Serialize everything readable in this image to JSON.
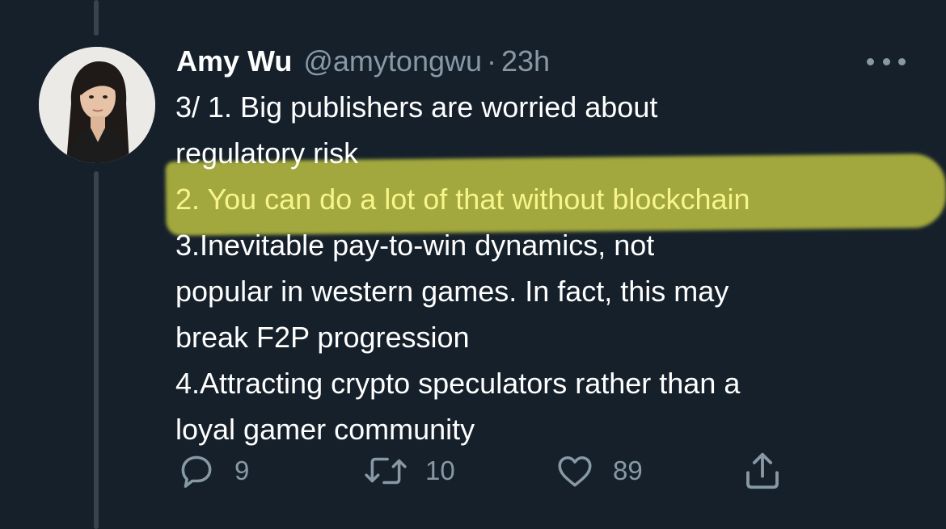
{
  "tweet": {
    "author_name": "Amy Wu",
    "handle": "@amytongwu",
    "separator": "·",
    "time": "23h",
    "lines": [
      "3/ 1. Big publishers are worried about",
      "regulatory risk",
      "2. You can do a lot of that without blockchain",
      "3.Inevitable pay-to-win dynamics, not",
      "popular in western games. In fact, this may",
      "break F2P progression",
      "4.Attracting crypto speculators rather than a",
      "loyal gamer community"
    ],
    "highlighted_line_index": 2,
    "highlight_color": "#c9ce42"
  },
  "actions": {
    "reply_count": "9",
    "retweet_count": "10",
    "like_count": "89"
  },
  "icons": {
    "more": "more-horizontal-icon",
    "reply": "reply-icon",
    "retweet": "retweet-icon",
    "like": "heart-icon",
    "share": "share-icon"
  },
  "colors": {
    "background": "#15202b",
    "muted": "#8899a6",
    "text": "#ffffff"
  }
}
